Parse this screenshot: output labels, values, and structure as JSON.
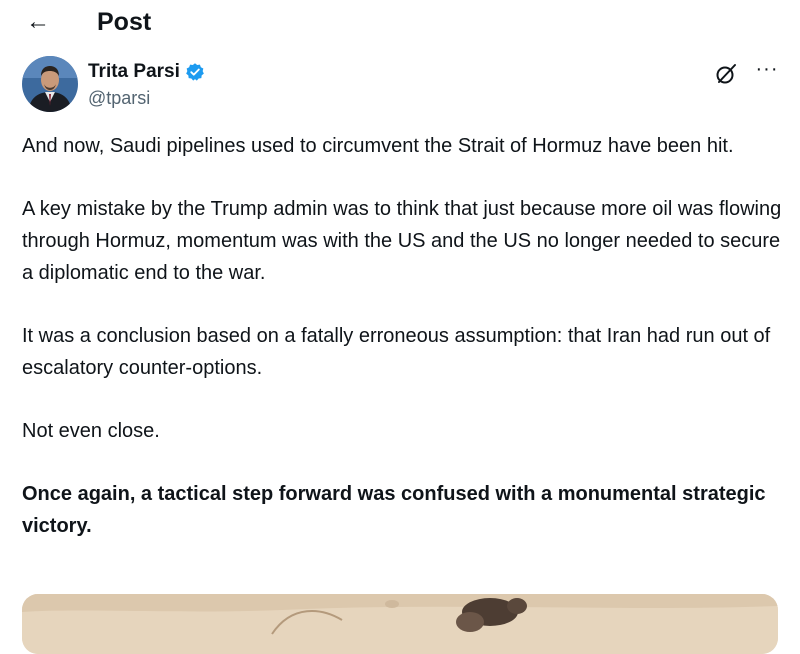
{
  "header": {
    "back_glyph": "←",
    "title": "Post"
  },
  "author": {
    "display_name": "Trita Parsi",
    "handle": "@tparsi",
    "verified_color": "#1d9bf0",
    "avatar_icon": "profile-photo"
  },
  "actions": {
    "grok_icon": "grok-icon",
    "more_glyph": "···"
  },
  "post": {
    "paragraphs": [
      "And now, Saudi pipelines used to circumvent the Strait of Hormuz have been hit.",
      "A key mistake by the Trump admin was to think that just because more oil was flowing through Hormuz, momentum was with the US and the US no longer needed to secure a diplomatic end to the war.",
      "It was a conclusion based on a fatally erroneous assumption: that Iran had run out of escalatory counter-options.",
      "Not even close.",
      "Once again, a tactical step forward was confused with a monumental strategic victory."
    ]
  },
  "media": {
    "kind": "image",
    "description_icon": "attached-photo"
  }
}
